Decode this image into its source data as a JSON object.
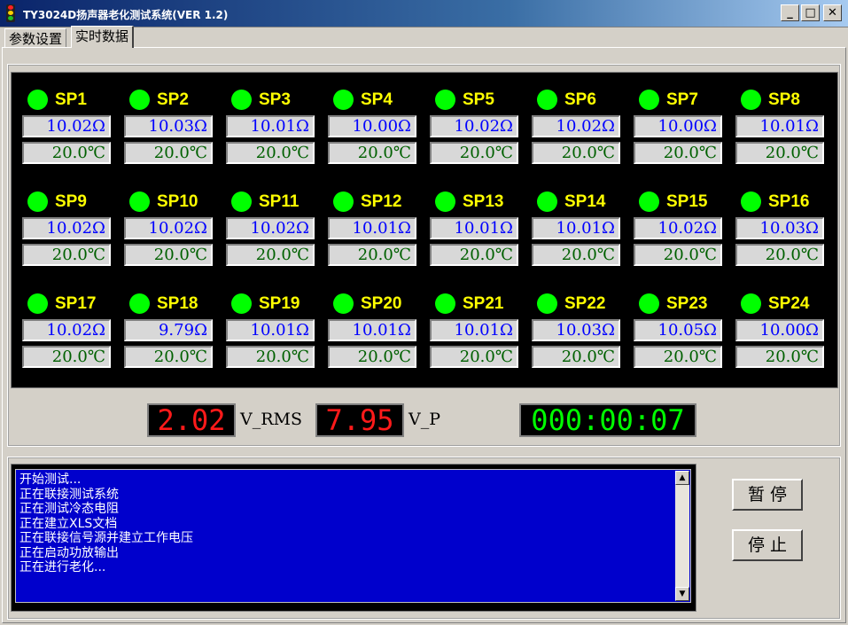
{
  "window": {
    "title": "TY3024D扬声器老化测试系统(VER 1.2)",
    "minimize": "_",
    "maximize": "□",
    "close": "✕"
  },
  "tabs": [
    {
      "label": "参数设置",
      "active": false
    },
    {
      "label": "实时数据",
      "active": true
    }
  ],
  "speakers": [
    {
      "label": "SP1",
      "resistance": "10.02Ω",
      "temperature": "20.0℃",
      "status": "on"
    },
    {
      "label": "SP2",
      "resistance": "10.03Ω",
      "temperature": "20.0℃",
      "status": "on"
    },
    {
      "label": "SP3",
      "resistance": "10.01Ω",
      "temperature": "20.0℃",
      "status": "on"
    },
    {
      "label": "SP4",
      "resistance": "10.00Ω",
      "temperature": "20.0℃",
      "status": "on"
    },
    {
      "label": "SP5",
      "resistance": "10.02Ω",
      "temperature": "20.0℃",
      "status": "on"
    },
    {
      "label": "SP6",
      "resistance": "10.02Ω",
      "temperature": "20.0℃",
      "status": "on"
    },
    {
      "label": "SP7",
      "resistance": "10.00Ω",
      "temperature": "20.0℃",
      "status": "on"
    },
    {
      "label": "SP8",
      "resistance": "10.01Ω",
      "temperature": "20.0℃",
      "status": "on"
    },
    {
      "label": "SP9",
      "resistance": "10.02Ω",
      "temperature": "20.0℃",
      "status": "on"
    },
    {
      "label": "SP10",
      "resistance": "10.02Ω",
      "temperature": "20.0℃",
      "status": "on"
    },
    {
      "label": "SP11",
      "resistance": "10.02Ω",
      "temperature": "20.0℃",
      "status": "on"
    },
    {
      "label": "SP12",
      "resistance": "10.01Ω",
      "temperature": "20.0℃",
      "status": "on"
    },
    {
      "label": "SP13",
      "resistance": "10.01Ω",
      "temperature": "20.0℃",
      "status": "on"
    },
    {
      "label": "SP14",
      "resistance": "10.01Ω",
      "temperature": "20.0℃",
      "status": "on"
    },
    {
      "label": "SP15",
      "resistance": "10.02Ω",
      "temperature": "20.0℃",
      "status": "on"
    },
    {
      "label": "SP16",
      "resistance": "10.03Ω",
      "temperature": "20.0℃",
      "status": "on"
    },
    {
      "label": "SP17",
      "resistance": "10.02Ω",
      "temperature": "20.0℃",
      "status": "on"
    },
    {
      "label": "SP18",
      "resistance": "9.79Ω",
      "temperature": "20.0℃",
      "status": "on"
    },
    {
      "label": "SP19",
      "resistance": "10.01Ω",
      "temperature": "20.0℃",
      "status": "on"
    },
    {
      "label": "SP20",
      "resistance": "10.01Ω",
      "temperature": "20.0℃",
      "status": "on"
    },
    {
      "label": "SP21",
      "resistance": "10.01Ω",
      "temperature": "20.0℃",
      "status": "on"
    },
    {
      "label": "SP22",
      "resistance": "10.03Ω",
      "temperature": "20.0℃",
      "status": "on"
    },
    {
      "label": "SP23",
      "resistance": "10.05Ω",
      "temperature": "20.0℃",
      "status": "on"
    },
    {
      "label": "SP24",
      "resistance": "10.00Ω",
      "temperature": "20.0℃",
      "status": "on"
    }
  ],
  "readouts": {
    "v_rms_value": "2.02",
    "v_rms_unit": "V_RMS",
    "v_p_value": "7.95",
    "v_p_unit": "V_P",
    "elapsed": "000:00:07"
  },
  "log": {
    "lines": [
      "开始测试...",
      "正在联接测试系统",
      "正在测试冷态电阻",
      "正在建立XLS文档",
      "正在联接信号源并建立工作电压",
      "正在启动功放输出",
      "正在进行老化..."
    ]
  },
  "buttons": {
    "pause": "暂停",
    "stop": "停止"
  },
  "colors": {
    "led_on": "#00ff00",
    "label": "#ffff00",
    "resistance_text": "#0000ff",
    "temperature_text": "#006000",
    "lcd_red": "#ff1a1a",
    "lcd_green": "#00ff00",
    "log_bg": "#0000cc"
  },
  "icons": {
    "app": "traffic-light-icon",
    "scroll_up": "arrow-up-icon",
    "scroll_down": "arrow-down-icon"
  }
}
